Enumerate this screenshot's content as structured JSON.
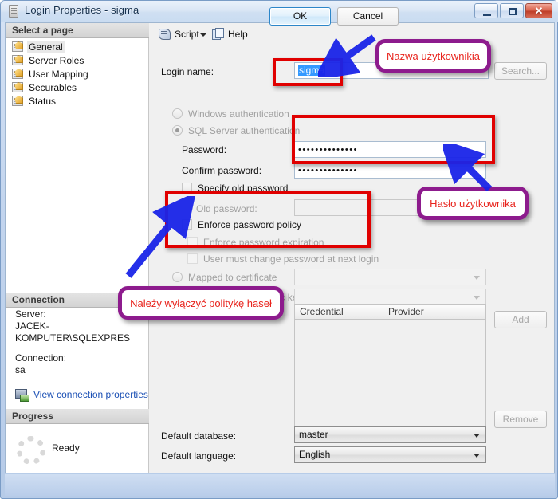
{
  "window": {
    "title": "Login Properties - sigma",
    "icon": "database-login-icon",
    "minimize": "–",
    "maximize": "□",
    "close": "✕"
  },
  "sidebar": {
    "select_page_header": "Select a page",
    "items": [
      {
        "label": "General",
        "selected": true
      },
      {
        "label": "Server Roles",
        "selected": false
      },
      {
        "label": "User Mapping",
        "selected": false
      },
      {
        "label": "Securables",
        "selected": false
      },
      {
        "label": "Status",
        "selected": false
      }
    ],
    "connection": {
      "header": "Connection",
      "server_label": "Server:",
      "server_value": "JACEK-KOMPUTER\\SQLEXPRES",
      "connection_label": "Connection:",
      "connection_value": "sa",
      "view_properties_link": "View connection properties"
    },
    "progress": {
      "header": "Progress",
      "status": "Ready"
    }
  },
  "toolbar": {
    "script_label": "Script",
    "script_icon": "script-icon",
    "dropdown_icon": "chevron-down-icon",
    "help_label": "Help",
    "help_icon": "help-pages-icon"
  },
  "form": {
    "login_name_label": "Login name:",
    "login_name_value": "sigma",
    "search_button": "Search...",
    "windows_auth_label": "Windows authentication",
    "sql_auth_label": "SQL Server authentication",
    "password_label": "Password:",
    "password_value": "••••••••••••••",
    "confirm_password_label": "Confirm password:",
    "confirm_password_value": "••••••••••••••",
    "specify_old_password_label": "Specify old password",
    "old_password_label": "Old password:",
    "old_password_value": "",
    "enforce_policy_label": "Enforce password policy",
    "enforce_expiration_label": "Enforce password expiration",
    "must_change_label": "User must change password at next login",
    "mapped_certificate_label": "Mapped to certificate",
    "mapped_certificate_value": "",
    "mapped_asymmetric_label": "Mapped to asymmetric key",
    "mapped_asymmetric_value": "",
    "credential_combo_value": "",
    "add_button": "Add",
    "remove_button": "Remove",
    "credential_columns": [
      "Credential",
      "Provider"
    ],
    "credential_rows": [],
    "default_database_label": "Default database:",
    "default_database_value": "master",
    "default_language_label": "Default language:",
    "default_language_value": "English"
  },
  "footer": {
    "ok_label": "OK",
    "cancel_label": "Cancel"
  },
  "annotations": {
    "callout_username": "Nazwa użytkownikia",
    "callout_password": "Hasło użytkownika",
    "callout_policy": "Należy wyłączyć politykę haseł",
    "highlight_color": "#e00000",
    "callout_border_color": "#8d1b8d",
    "callout_text_color": "#e8231c",
    "arrow_color": "#1a24e8"
  }
}
